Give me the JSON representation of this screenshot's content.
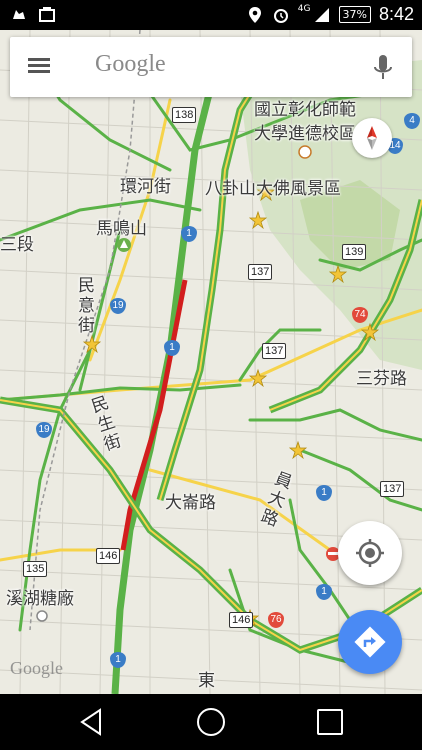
{
  "status_bar": {
    "network": "4G",
    "battery": "37%",
    "time": "8:42"
  },
  "search": {
    "placeholder": "Google"
  },
  "map": {
    "labels": {
      "top_right_1": "國立彰化師範",
      "top_right_2": "大學進德校區",
      "bagua": "八卦山大佛風景區",
      "huanhe": "環河街",
      "mamingshan": "馬鳴山",
      "sanduan": "三段",
      "minyi": "民意街",
      "minsheng": "民生街",
      "sanfen": "三芬路",
      "datai": "大崙路",
      "yuanda": "員大路",
      "xihu": "溪湖糖廠",
      "dong": "東"
    },
    "shields": {
      "r138": "138",
      "r137a": "137",
      "r139": "139",
      "r137b": "137",
      "r137c": "137",
      "r146": "146",
      "r135": "135",
      "r146b": "146"
    },
    "freeways": {
      "f1a": "1",
      "f1b": "1",
      "f1c": "1",
      "f1d": "1",
      "f1e": "1",
      "f19a": "19",
      "f19b": "19",
      "f74": "74",
      "f76": "76",
      "f14": "14",
      "f4": "4"
    },
    "watermark": "Google"
  }
}
